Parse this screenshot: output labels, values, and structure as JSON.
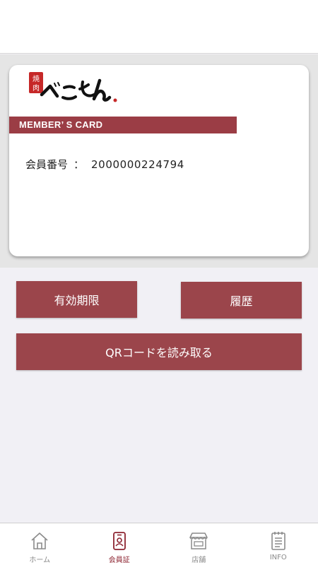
{
  "card": {
    "logo_text": "焼肉 べことん",
    "band_title": "MEMBER’ S CARD",
    "member_label": "会員番号",
    "separator": "：",
    "member_number": "2000000224794"
  },
  "buttons": {
    "expiry": "有効期限",
    "history": "履歴",
    "qr": "QRコードを読み取る"
  },
  "tabs": [
    {
      "label": "ホーム",
      "icon": "home-icon",
      "active": false
    },
    {
      "label": "会員証",
      "icon": "member-card-icon",
      "active": true
    },
    {
      "label": "店舗",
      "icon": "store-icon",
      "active": false
    },
    {
      "label": "INFO",
      "icon": "info-clipboard-icon",
      "active": false
    }
  ],
  "colors": {
    "brand": "#9b3d45",
    "button": "#9b454b",
    "tab_active": "#8c2330",
    "tab_inactive": "#8a8a8a"
  }
}
